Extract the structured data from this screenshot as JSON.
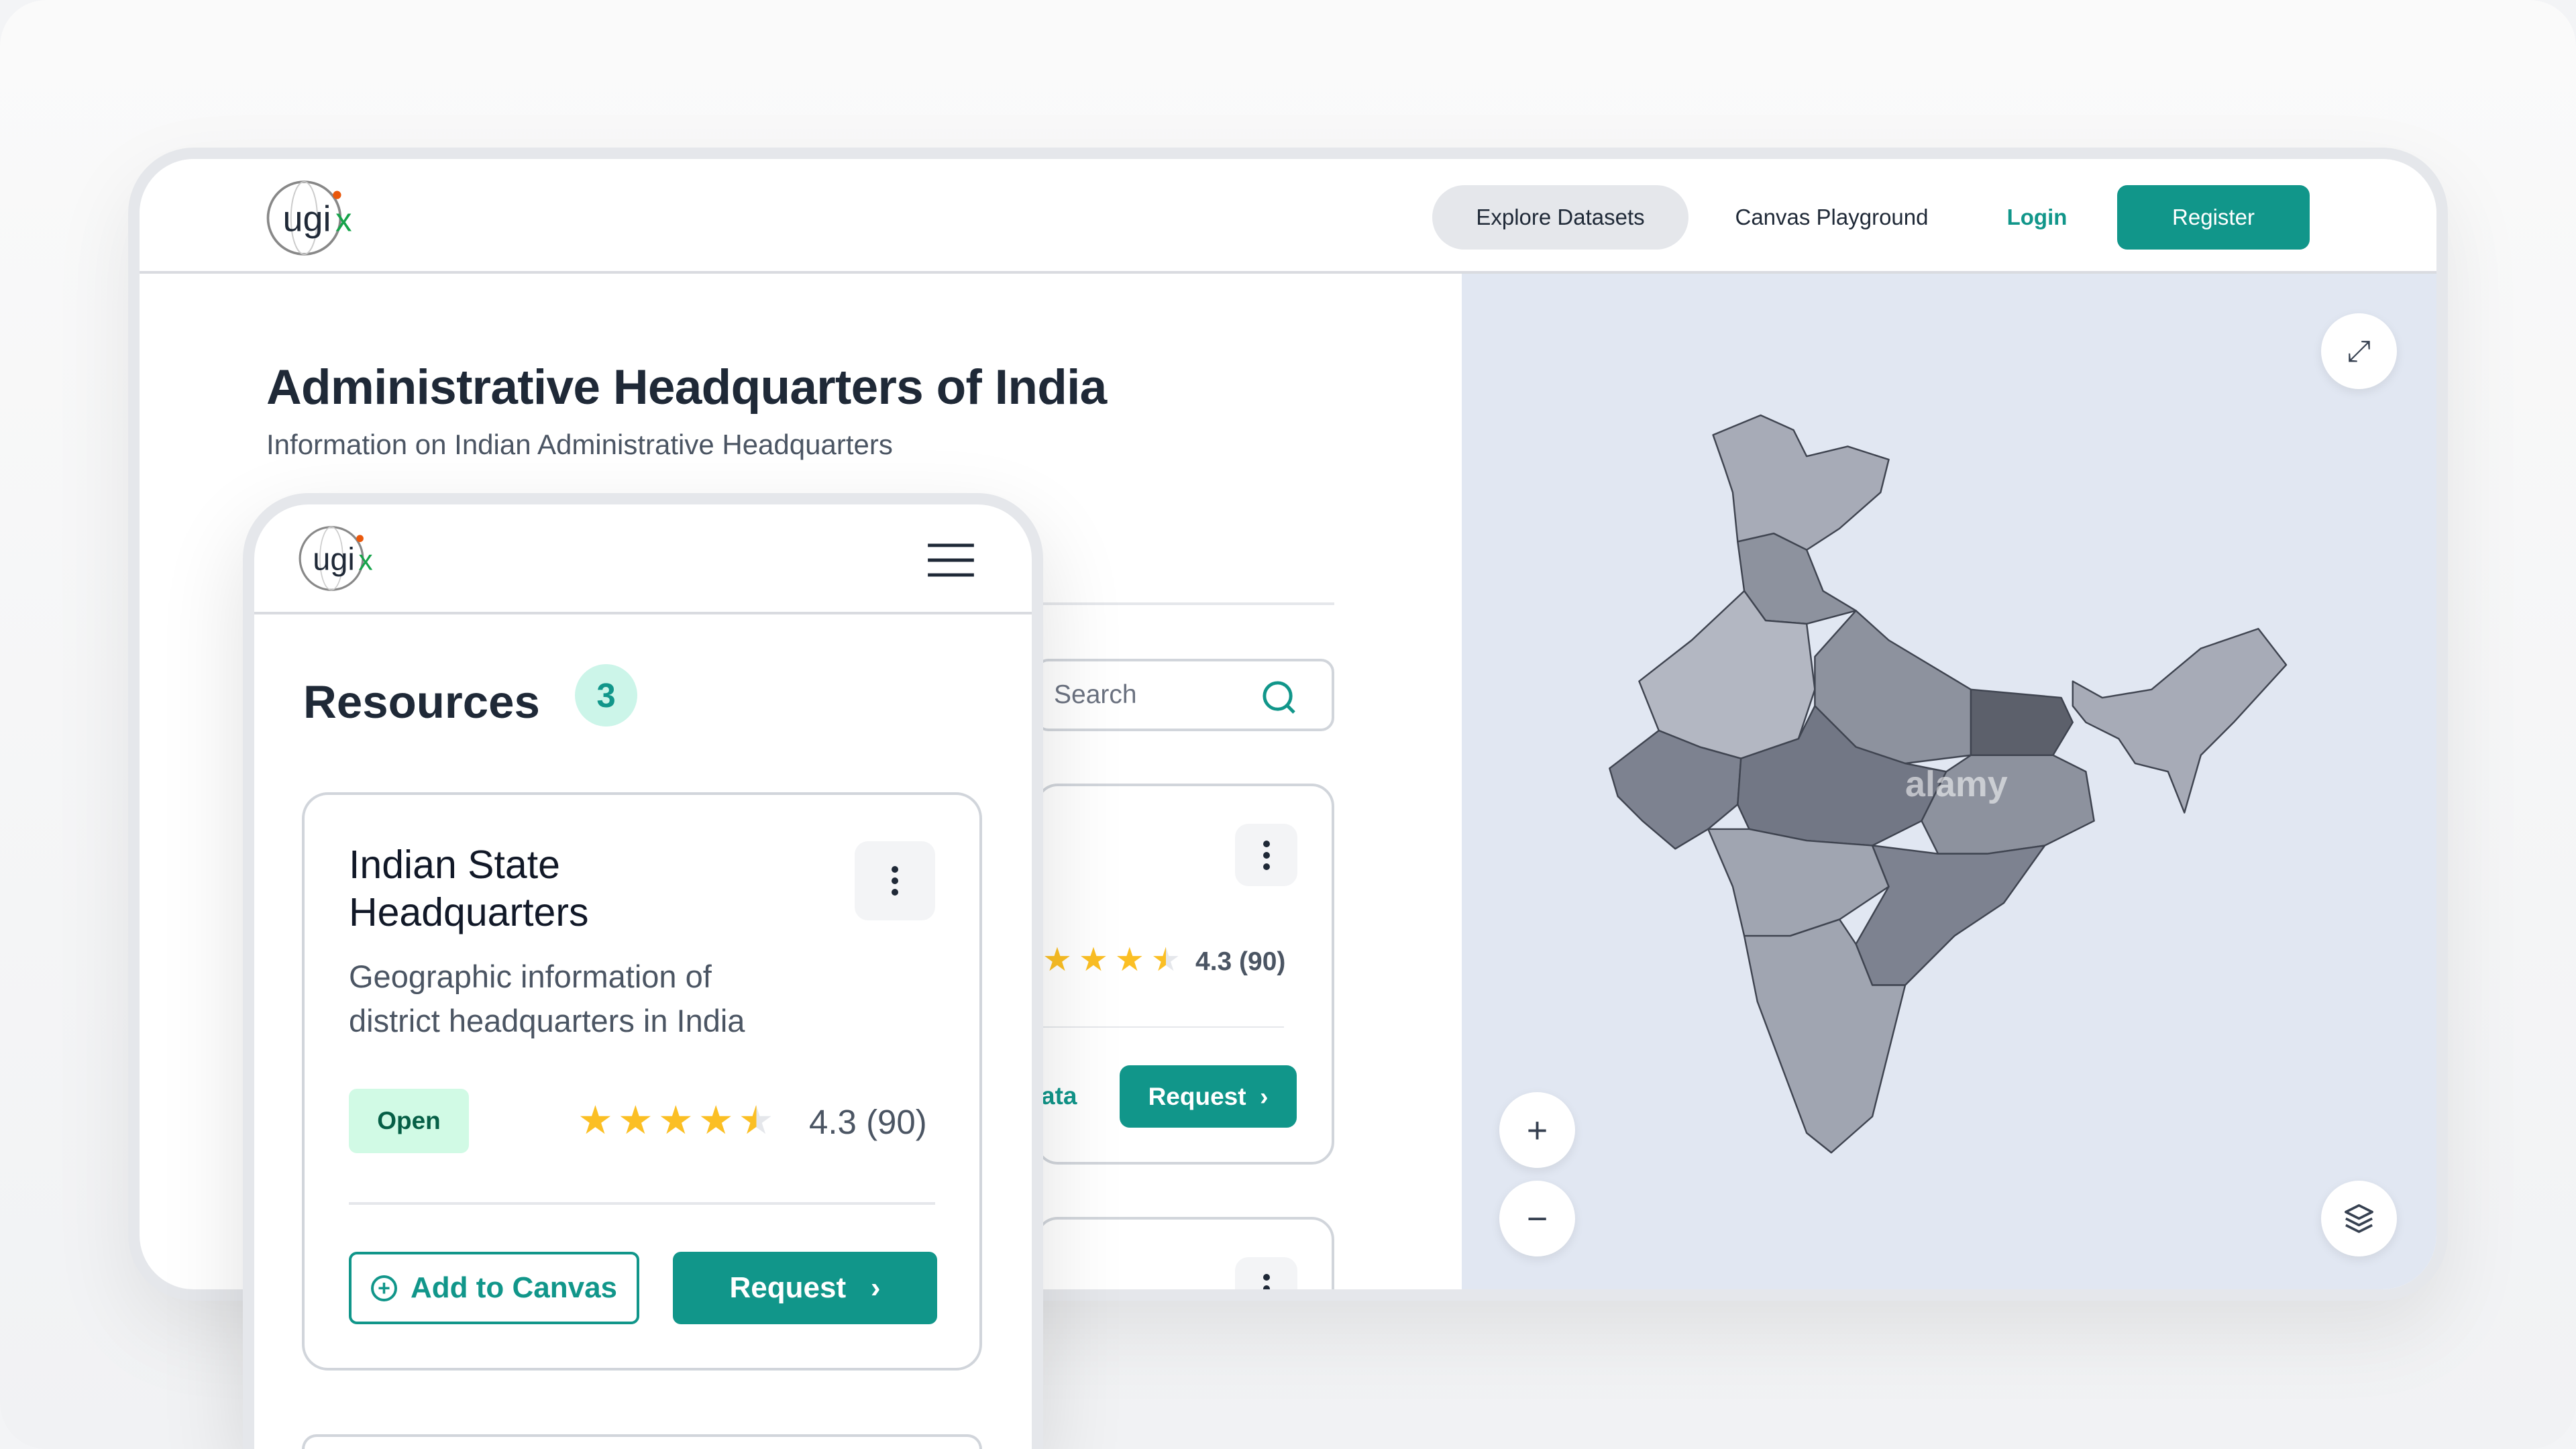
{
  "brand": {
    "logo_text": "ugix"
  },
  "nav": {
    "explore": "Explore Datasets",
    "canvas": "Canvas Playground",
    "login": "Login",
    "register": "Register"
  },
  "page": {
    "title": "Administrative Headquarters of India",
    "subtitle": "Information on Indian Administrative Headquarters"
  },
  "desktop_list": {
    "search_placeholder": "Search",
    "card": {
      "rating": "4.3 (90)",
      "rating_value": 4.3,
      "link_fragment": "ata",
      "request": "Request"
    }
  },
  "map": {
    "watermark": "alamy",
    "background": "#e1e7f2",
    "controls": {
      "expand": "expand-icon",
      "zoom_in": "+",
      "zoom_out": "−",
      "layers": "layers-icon"
    }
  },
  "mobile": {
    "resources_title": "Resources",
    "resources_count": "3",
    "card": {
      "title_line1": "Indian State",
      "title_line2": "Headquarters",
      "description_line1": "Geographic information of",
      "description_line2": "district headquarters in India",
      "badge": "Open",
      "rating": "4.3 (90)",
      "rating_value": 4.3,
      "add_to_canvas": "Add to Canvas",
      "request": "Request"
    }
  },
  "colors": {
    "accent": "#11968a",
    "badge_bg": "#d1fae5",
    "star": "#fbbf24"
  }
}
